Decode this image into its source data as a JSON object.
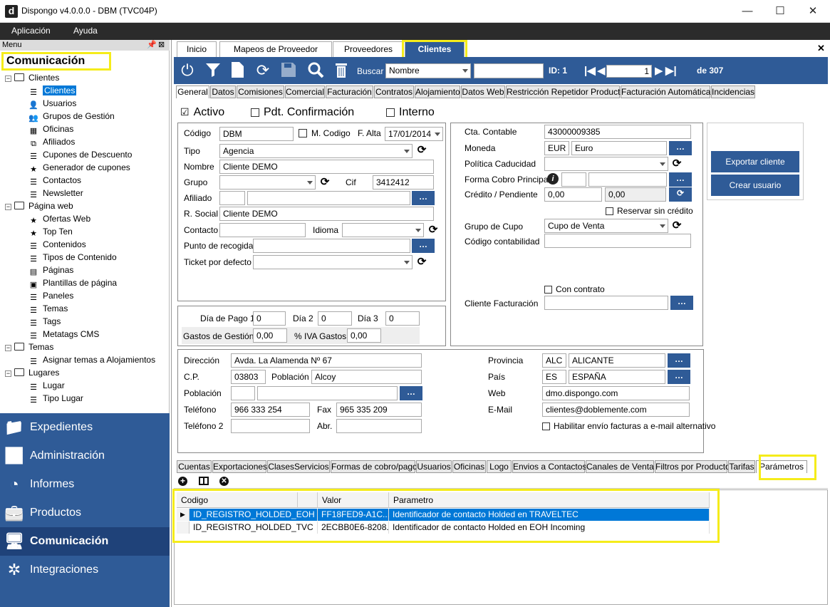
{
  "window": {
    "title": "Dispongo v4.0.0.0 - DBM (TVC04P)",
    "logo": "d",
    "minimize": "—",
    "maximize": "☐",
    "close": "✕"
  },
  "menubar": {
    "items": [
      "Aplicación",
      "Ayuda"
    ]
  },
  "sidebar": {
    "header": "Menu",
    "section_title": "Comunicación",
    "tree": [
      {
        "label": "Clientes",
        "level": 0,
        "icon": "folder-icon"
      },
      {
        "label": "Clientes",
        "level": 1,
        "icon": "customer-list-icon",
        "selected": true
      },
      {
        "label": "Usuarios",
        "level": 1,
        "icon": "user-icon"
      },
      {
        "label": "Grupos de Gestión",
        "level": 1,
        "icon": "group-icon"
      },
      {
        "label": "Oficinas",
        "level": 1,
        "icon": "building-icon"
      },
      {
        "label": "Afiliados",
        "level": 1,
        "icon": "network-icon"
      },
      {
        "label": "Cupones de Descuento",
        "level": 1,
        "icon": "list-icon"
      },
      {
        "label": "Generador de cupones",
        "level": 1,
        "icon": "star-icon"
      },
      {
        "label": "Contactos",
        "level": 1,
        "icon": "customer-list-icon"
      },
      {
        "label": "Newsletter",
        "level": 1,
        "icon": "customer-list-icon"
      },
      {
        "label": "Página web",
        "level": 0,
        "icon": "folder-icon"
      },
      {
        "label": "Ofertas Web",
        "level": 1,
        "icon": "star-icon"
      },
      {
        "label": "Top Ten",
        "level": 1,
        "icon": "star-icon"
      },
      {
        "label": "Contenidos",
        "level": 1,
        "icon": "list-icon"
      },
      {
        "label": "Tipos de Contenido",
        "level": 1,
        "icon": "list-icon"
      },
      {
        "label": "Páginas",
        "level": 1,
        "icon": "pages-icon"
      },
      {
        "label": "Plantillas de página",
        "level": 1,
        "icon": "template-icon"
      },
      {
        "label": "Paneles",
        "level": 1,
        "icon": "list-icon"
      },
      {
        "label": "Temas",
        "level": 1,
        "icon": "list-icon"
      },
      {
        "label": "Tags",
        "level": 1,
        "icon": "list-icon"
      },
      {
        "label": "Metatags CMS",
        "level": 1,
        "icon": "list-icon"
      },
      {
        "label": "Temas",
        "level": 0,
        "icon": "folder-icon"
      },
      {
        "label": "Asignar temas a Alojamientos",
        "level": 1,
        "icon": "list-icon"
      },
      {
        "label": "Lugares",
        "level": 0,
        "icon": "folder-icon"
      },
      {
        "label": "Lugar",
        "level": 1,
        "icon": "list-icon"
      },
      {
        "label": "Tipo Lugar",
        "level": 1,
        "icon": "list-icon"
      }
    ],
    "nav": [
      {
        "label": "Expedientes",
        "icon": "folder-icon"
      },
      {
        "label": "Administración",
        "icon": "bar-chart-icon"
      },
      {
        "label": "Informes",
        "icon": "pie-chart-icon"
      },
      {
        "label": "Productos",
        "icon": "briefcase-icon"
      },
      {
        "label": "Comunicación",
        "icon": "monitor-icon",
        "selected": true
      },
      {
        "label": "Integraciones",
        "icon": "puzzle-icon"
      }
    ]
  },
  "main_tabs": [
    "Inicio",
    "Mapeos de Proveedor",
    "Proveedores",
    "Clientes"
  ],
  "close_label": "✕",
  "toolbar": {
    "search_label": "Buscar",
    "search_field": "Nombre",
    "id_label": "ID: 1",
    "page": "1",
    "of_label": "de 307"
  },
  "section_tabs": [
    "General",
    "Datos",
    "Comisiones",
    "Comercial",
    "Facturación",
    "Contratos",
    "Alojamiento",
    "Datos Web",
    "Restricción Repetidor Producto",
    "Facturación Automática",
    "Incidencias"
  ],
  "status": {
    "activo": "Activo",
    "pdt": "Pdt. Confirmación",
    "interno": "Interno"
  },
  "form": {
    "codigo_label": "Código",
    "codigo": "DBM",
    "mcodigo_label": "M. Codigo",
    "falta_label": "F. Alta",
    "falta": "17/01/2014",
    "tipo_label": "Tipo",
    "tipo": "Agencia",
    "nombre_label": "Nombre",
    "nombre": "Cliente DEMO",
    "grupo_label": "Grupo",
    "cif_label": "Cif",
    "cif": "3412412",
    "afiliado_label": "Afiliado",
    "rsocial_label": "R. Social",
    "rsocial": "Cliente DEMO",
    "contacto_label": "Contacto",
    "idioma_label": "Idioma",
    "punto_label": "Punto de recogida",
    "ticket_label": "Ticket por defecto",
    "dia_pago_label": "Día de Pago 1",
    "dia_pago": "0",
    "dia2_label": "Día 2",
    "dia2": "0",
    "dia3_label": "Día 3",
    "dia3": "0",
    "gastos_label": "Gastos de Gestión",
    "gastos": "0,00",
    "iva_label": "% IVA Gastos",
    "iva": "0,00"
  },
  "right_form": {
    "cta_label": "Cta. Contable",
    "cta": "43000009385",
    "moneda_label": "Moneda",
    "moneda_code": "EUR",
    "moneda_name": "Euro",
    "politica_label": "Política Caducidad",
    "forma_label": "Forma Cobro Principal",
    "credito_label": "Crédito / Pendiente",
    "credito": "0,00",
    "pendiente": "0,00",
    "reservar_label": "Reservar sin crédito",
    "cupo_label": "Grupo de Cupo",
    "cupo": "Cupo de Venta",
    "codcont_label": "Código contabilidad",
    "contrato_label": "Con contrato",
    "clifact_label": "Cliente Facturación",
    "export_btn": "Exportar cliente",
    "crear_btn": "Crear usuario"
  },
  "address": {
    "dir_label": "Dirección",
    "dir": "Avda. La Alamenda Nº 67",
    "cp_label": "C.P.",
    "cp": "03803",
    "pob_label": "Población",
    "pob": "Alcoy",
    "pob2_label": "Población",
    "tel_label": "Teléfono",
    "tel": "966 333 254",
    "fax_label": "Fax",
    "fax": "965 335 209",
    "tel2_label": "Teléfono 2",
    "abr_label": "Abr.",
    "prov_label": "Provincia",
    "prov_code": "ALC",
    "prov_name": "ALICANTE",
    "pais_label": "País",
    "pais_code": "ES",
    "pais_name": "ESPAÑA",
    "web_label": "Web",
    "web": "dmo.dispongo.com",
    "email_label": "E-Mail",
    "email": "clientes@doblemente.com",
    "habilitar_label": "Habilitar envío facturas a e-mail alternativo"
  },
  "bottom_tabs": [
    "Cuentas",
    "Exportaciones",
    "ClasesServicios",
    "Formas de cobro/pago",
    "Usuarios",
    "Oficinas",
    "Logo",
    "Envios a Contactos",
    "Canales de Venta",
    "Filtros por Producto",
    "Tarifas",
    "Parámetros"
  ],
  "grid": {
    "headers": [
      "Codigo",
      "Valor",
      "Parametro"
    ],
    "rows": [
      [
        "ID_REGISTRO_HOLDED_EOH",
        "FF18FED9-A1C...",
        "Identificador de contacto Holded en TRAVELTEC"
      ],
      [
        "ID_REGISTRO_HOLDED_TVC",
        "2ECBB0E6-8208...",
        "Identificador de contacto Holded en EOH Incoming"
      ]
    ]
  },
  "colors": {
    "accent": "#2f5b97",
    "highlight": "#f5ec1a",
    "selection": "#0078d7"
  }
}
